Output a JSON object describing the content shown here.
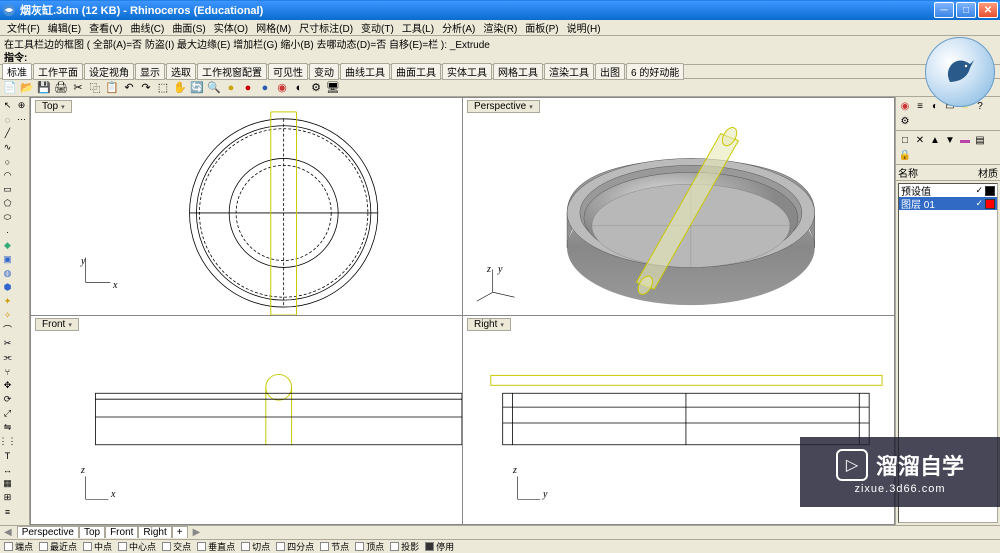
{
  "title": "烟灰缸.3dm (12 KB) - Rhinoceros (Educational)",
  "menu": [
    "文件(F)",
    "编辑(E)",
    "查看(V)",
    "曲线(C)",
    "曲面(S)",
    "实体(O)",
    "网格(M)",
    "尺寸标注(D)",
    "变动(T)",
    "工具(L)",
    "分析(A)",
    "渲染(R)",
    "面板(P)",
    "说明(H)"
  ],
  "cmd_history": "在工具栏边的框图 ( 全部(A)=否  防盗(I)  最大边缘(E)  增加栏(G)  缩小(B)  去哪动态(D)=否  自移(E)=栏 ): _Extrude",
  "cmd_prompt": "指令:",
  "toolbar_tabs": [
    "标准",
    "工作平面",
    "设定视角",
    "显示",
    "选取",
    "工作视窗配置",
    "可见性",
    "变动",
    "曲线工具",
    "曲面工具",
    "实体工具",
    "网格工具",
    "渲染工具",
    "出图",
    "6 的好动能"
  ],
  "viewports": {
    "top": "Top",
    "perspective": "Perspective",
    "front": "Front",
    "right": "Right"
  },
  "axis": {
    "x": "x",
    "y": "y",
    "z": "z"
  },
  "layers_panel": {
    "header_name": "名称",
    "header_props": "材质",
    "rows": [
      {
        "name": "预设值",
        "sel": false,
        "color": "#000000"
      },
      {
        "name": "图层 01",
        "sel": true,
        "color": "#ff0000"
      }
    ]
  },
  "bottom_tabs": [
    "Perspective",
    "Top",
    "Front",
    "Right",
    "+"
  ],
  "status": [
    "端点",
    "最近点",
    "中点",
    "中心点",
    "交点",
    "垂直点",
    "切点",
    "四分点",
    "节点",
    "顶点",
    "投影",
    "停用"
  ],
  "status_active": "停用",
  "watermark": {
    "text": "溜溜自学",
    "url": "zixue.3d66.com"
  }
}
